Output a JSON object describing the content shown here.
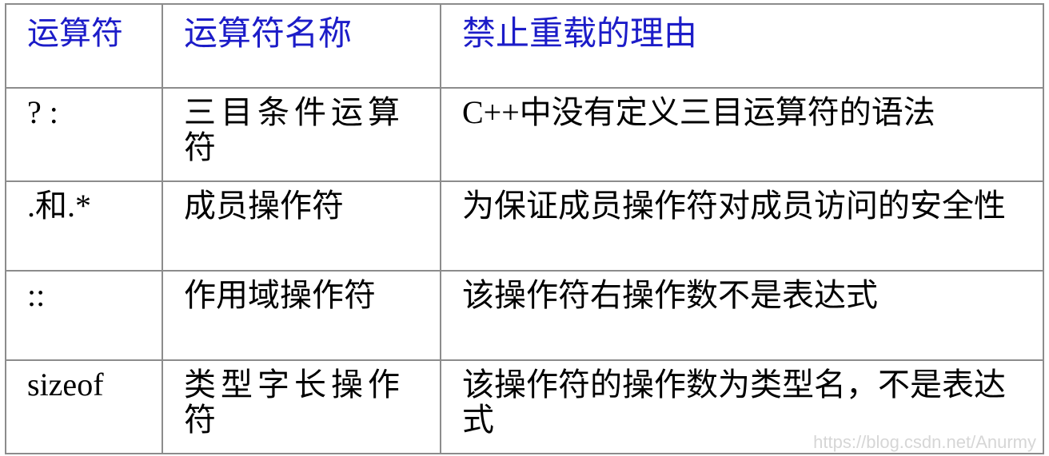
{
  "table": {
    "headers": {
      "operator": "运算符",
      "name": "运算符名称",
      "reason": "禁止重载的理由"
    },
    "rows": [
      {
        "operator": "? :",
        "name": "三目条件运算符",
        "reason": "C++中没有定义三目运算符的语法"
      },
      {
        "operator": ".和.*",
        "name": "成员操作符",
        "reason": "为保证成员操作符对成员访问的安全性"
      },
      {
        "operator": "::",
        "name": "作用域操作符",
        "reason": "该操作符右操作数不是表达式"
      },
      {
        "operator": "sizeof",
        "name": "类型字长操作符",
        "reason": "该操作符的操作数为类型名，不是表达式"
      }
    ]
  },
  "watermark": "https://blog.csdn.net/Anurmy",
  "colors": {
    "header_text": "#1c1cc8",
    "border": "#8c8c8c",
    "watermark": "#d6d6d6"
  }
}
